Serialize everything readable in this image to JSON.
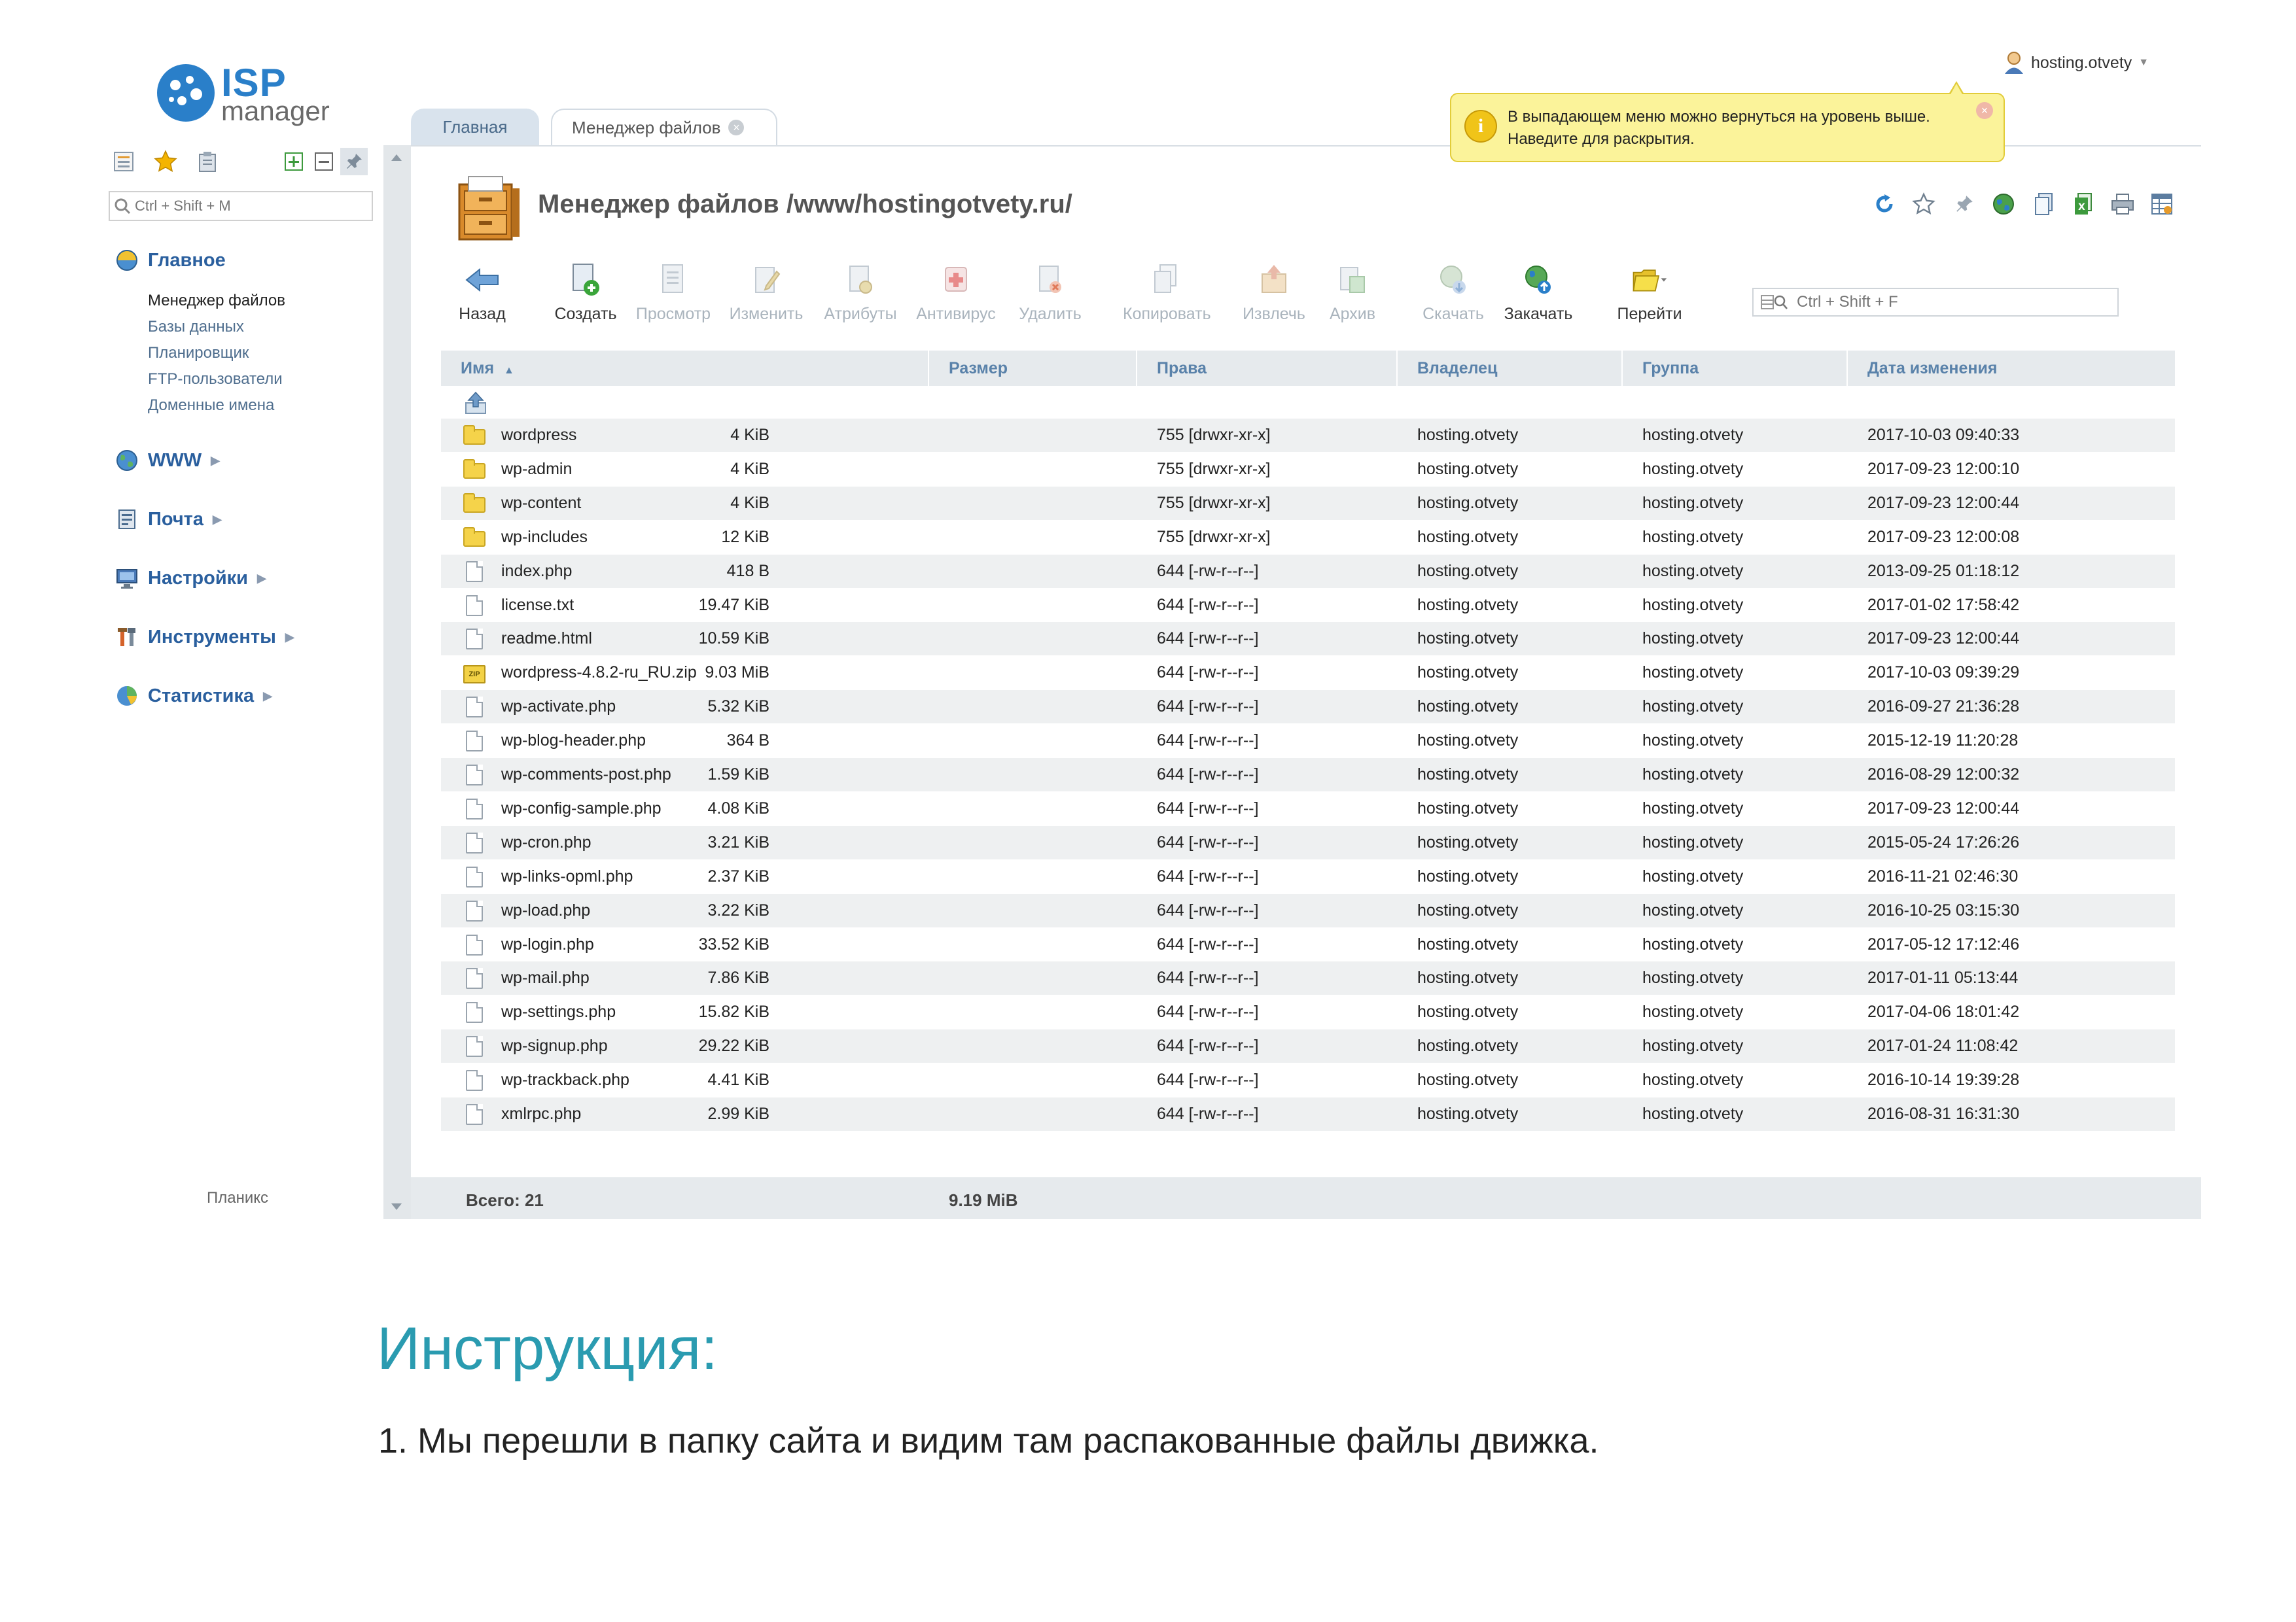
{
  "logo": {
    "brand": "ISP",
    "subtitle": "manager"
  },
  "user_menu": {
    "username": "hosting.otvety"
  },
  "sidebar": {
    "search_placeholder": "Ctrl + Shift + M",
    "sections": [
      {
        "label": "Главное",
        "icon": "home-globe-icon",
        "items": [
          "Менеджер файлов",
          "Базы данных",
          "Планировщик",
          "FTP-пользователи",
          "Доменные имена"
        ]
      },
      {
        "label": "WWW",
        "icon": "www-globe-icon"
      },
      {
        "label": "Почта",
        "icon": "mail-icon"
      },
      {
        "label": "Настройки",
        "icon": "settings-monitor-icon"
      },
      {
        "label": "Инструменты",
        "icon": "tools-icon"
      },
      {
        "label": "Статистика",
        "icon": "statistics-pie-icon"
      }
    ],
    "footer": "Планикс"
  },
  "tabs": [
    {
      "label": "Главная"
    },
    {
      "label": "Менеджер файлов"
    }
  ],
  "page": {
    "title": "Менеджер файлов /www/hostingotvety.ru/"
  },
  "tooltip": {
    "text": "В выпадающем меню можно вернуться на уровень выше. Наведите для раскрытия."
  },
  "toolbar": [
    {
      "label": "Назад",
      "enabled": true
    },
    {
      "label": "Создать",
      "enabled": true
    },
    {
      "label": "Просмотр",
      "enabled": false
    },
    {
      "label": "Изменить",
      "enabled": false
    },
    {
      "label": "Атрибуты",
      "enabled": false
    },
    {
      "label": "Антивирус",
      "enabled": false
    },
    {
      "label": "Удалить",
      "enabled": false
    },
    {
      "label": "Копировать",
      "enabled": false
    },
    {
      "label": "Извлечь",
      "enabled": false
    },
    {
      "label": "Архив",
      "enabled": false
    },
    {
      "label": "Скачать",
      "enabled": false
    },
    {
      "label": "Закачать",
      "enabled": true
    },
    {
      "label": "Перейти",
      "enabled": true
    }
  ],
  "table_search_placeholder": "Ctrl + Shift + F",
  "table": {
    "columns": [
      "Имя",
      "Размер",
      "Права",
      "Владелец",
      "Группа",
      "Дата изменения"
    ],
    "sort_indicator": "▲",
    "rows": [
      {
        "type": "folder",
        "name": "wordpress",
        "size": "4 KiB",
        "perms": "755 [drwxr-xr-x]",
        "owner": "hosting.otvety",
        "group": "hosting.otvety",
        "date": "2017-10-03 09:40:33"
      },
      {
        "type": "folder",
        "name": "wp-admin",
        "size": "4 KiB",
        "perms": "755 [drwxr-xr-x]",
        "owner": "hosting.otvety",
        "group": "hosting.otvety",
        "date": "2017-09-23 12:00:10"
      },
      {
        "type": "folder",
        "name": "wp-content",
        "size": "4 KiB",
        "perms": "755 [drwxr-xr-x]",
        "owner": "hosting.otvety",
        "group": "hosting.otvety",
        "date": "2017-09-23 12:00:44"
      },
      {
        "type": "folder",
        "name": "wp-includes",
        "size": "12 KiB",
        "perms": "755 [drwxr-xr-x]",
        "owner": "hosting.otvety",
        "group": "hosting.otvety",
        "date": "2017-09-23 12:00:08"
      },
      {
        "type": "file",
        "name": "index.php",
        "size": "418 B",
        "perms": "644 [-rw-r--r--]",
        "owner": "hosting.otvety",
        "group": "hosting.otvety",
        "date": "2013-09-25 01:18:12"
      },
      {
        "type": "file",
        "name": "license.txt",
        "size": "19.47 KiB",
        "perms": "644 [-rw-r--r--]",
        "owner": "hosting.otvety",
        "group": "hosting.otvety",
        "date": "2017-01-02 17:58:42"
      },
      {
        "type": "file",
        "name": "readme.html",
        "size": "10.59 KiB",
        "perms": "644 [-rw-r--r--]",
        "owner": "hosting.otvety",
        "group": "hosting.otvety",
        "date": "2017-09-23 12:00:44"
      },
      {
        "type": "zip",
        "name": "wordpress-4.8.2-ru_RU.zip",
        "size": "9.03 MiB",
        "perms": "644 [-rw-r--r--]",
        "owner": "hosting.otvety",
        "group": "hosting.otvety",
        "date": "2017-10-03 09:39:29"
      },
      {
        "type": "file",
        "name": "wp-activate.php",
        "size": "5.32 KiB",
        "perms": "644 [-rw-r--r--]",
        "owner": "hosting.otvety",
        "group": "hosting.otvety",
        "date": "2016-09-27 21:36:28"
      },
      {
        "type": "file",
        "name": "wp-blog-header.php",
        "size": "364 B",
        "perms": "644 [-rw-r--r--]",
        "owner": "hosting.otvety",
        "group": "hosting.otvety",
        "date": "2015-12-19 11:20:28"
      },
      {
        "type": "file",
        "name": "wp-comments-post.php",
        "size": "1.59 KiB",
        "perms": "644 [-rw-r--r--]",
        "owner": "hosting.otvety",
        "group": "hosting.otvety",
        "date": "2016-08-29 12:00:32"
      },
      {
        "type": "file",
        "name": "wp-config-sample.php",
        "size": "4.08 KiB",
        "perms": "644 [-rw-r--r--]",
        "owner": "hosting.otvety",
        "group": "hosting.otvety",
        "date": "2017-09-23 12:00:44"
      },
      {
        "type": "file",
        "name": "wp-cron.php",
        "size": "3.21 KiB",
        "perms": "644 [-rw-r--r--]",
        "owner": "hosting.otvety",
        "group": "hosting.otvety",
        "date": "2015-05-24 17:26:26"
      },
      {
        "type": "file",
        "name": "wp-links-opml.php",
        "size": "2.37 KiB",
        "perms": "644 [-rw-r--r--]",
        "owner": "hosting.otvety",
        "group": "hosting.otvety",
        "date": "2016-11-21 02:46:30"
      },
      {
        "type": "file",
        "name": "wp-load.php",
        "size": "3.22 KiB",
        "perms": "644 [-rw-r--r--]",
        "owner": "hosting.otvety",
        "group": "hosting.otvety",
        "date": "2016-10-25 03:15:30"
      },
      {
        "type": "file",
        "name": "wp-login.php",
        "size": "33.52 KiB",
        "perms": "644 [-rw-r--r--]",
        "owner": "hosting.otvety",
        "group": "hosting.otvety",
        "date": "2017-05-12 17:12:46"
      },
      {
        "type": "file",
        "name": "wp-mail.php",
        "size": "7.86 KiB",
        "perms": "644 [-rw-r--r--]",
        "owner": "hosting.otvety",
        "group": "hosting.otvety",
        "date": "2017-01-11 05:13:44"
      },
      {
        "type": "file",
        "name": "wp-settings.php",
        "size": "15.82 KiB",
        "perms": "644 [-rw-r--r--]",
        "owner": "hosting.otvety",
        "group": "hosting.otvety",
        "date": "2017-04-06 18:01:42"
      },
      {
        "type": "file",
        "name": "wp-signup.php",
        "size": "29.22 KiB",
        "perms": "644 [-rw-r--r--]",
        "owner": "hosting.otvety",
        "group": "hosting.otvety",
        "date": "2017-01-24 11:08:42"
      },
      {
        "type": "file",
        "name": "wp-trackback.php",
        "size": "4.41 KiB",
        "perms": "644 [-rw-r--r--]",
        "owner": "hosting.otvety",
        "group": "hosting.otvety",
        "date": "2016-10-14 19:39:28"
      },
      {
        "type": "file",
        "name": "xmlrpc.php",
        "size": "2.99 KiB",
        "perms": "644 [-rw-r--r--]",
        "owner": "hosting.otvety",
        "group": "hosting.otvety",
        "date": "2016-08-31 16:31:30"
      }
    ]
  },
  "footer": {
    "total": "Всего: 21",
    "total_size": "9.19 MiB"
  },
  "instructions": {
    "title": "Инструкция:",
    "step1": "1. Мы перешли в папку сайта и видим там распакованные файлы движка."
  },
  "colors": {
    "accent": "#2a7fc9",
    "link": "#2a5f9e",
    "header_text": "#5a82aa",
    "tooltip_bg": "#fbf39a",
    "instructions_title": "#2a9bb0"
  }
}
